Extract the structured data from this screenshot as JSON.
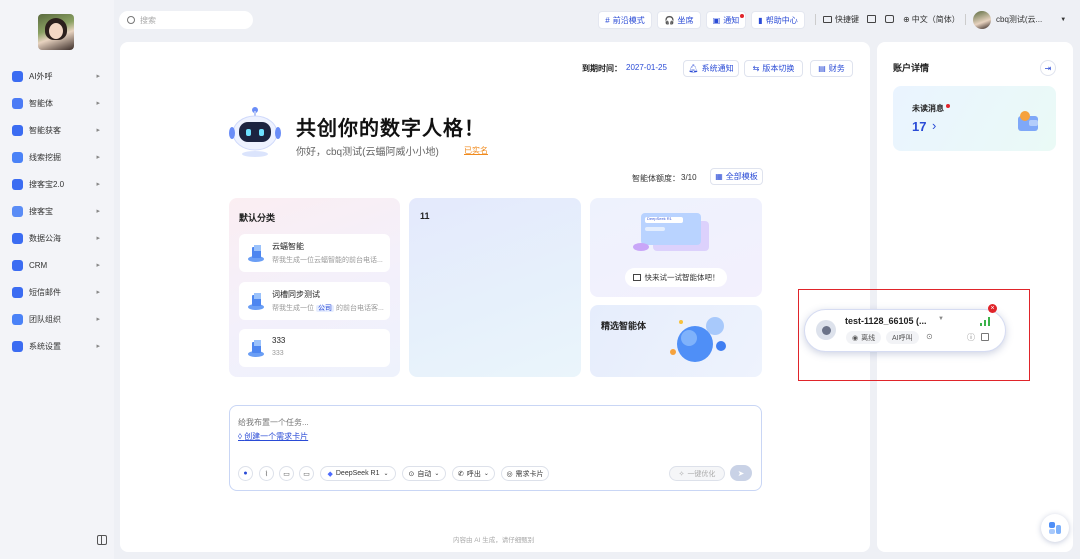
{
  "sidebar": {
    "items": [
      {
        "label": "AI外呼",
        "icon": "phone-robot-icon",
        "color": "#3b6cf2"
      },
      {
        "label": "智能体",
        "icon": "agent-icon",
        "color": "#4c7bf5"
      },
      {
        "label": "智能获客",
        "icon": "customer-icon",
        "color": "#3b6cf2"
      },
      {
        "label": "线索挖掘",
        "icon": "clue-icon",
        "color": "#4a82f7"
      },
      {
        "label": "搜客宝2.0",
        "icon": "search-customer-icon",
        "color": "#3b6cf2"
      },
      {
        "label": "搜客宝",
        "icon": "search-customer-icon",
        "color": "#5a8cf6"
      },
      {
        "label": "数据公海",
        "icon": "data-sea-icon",
        "color": "#3b6cf2"
      },
      {
        "label": "CRM",
        "icon": "crm-icon",
        "color": "#3b6cf2"
      },
      {
        "label": "短信邮件",
        "icon": "mail-icon",
        "color": "#3b6cf2"
      },
      {
        "label": "团队组织",
        "icon": "team-icon",
        "color": "#4a82f7"
      },
      {
        "label": "系统设置",
        "icon": "gear-icon",
        "color": "#3b6cf2"
      }
    ]
  },
  "topbar": {
    "search_placeholder": "搜索",
    "buttons": [
      "前沿模式",
      "坐席",
      "通知",
      "帮助中心"
    ],
    "links": [
      "快捷键",
      "中文（简体）"
    ],
    "user_name": "cbq测试(云..."
  },
  "main": {
    "expire_label": "到期时间：",
    "expire_date": "2027-01-25",
    "header_chips": [
      "系统通知",
      "版本切换",
      "财务"
    ],
    "hero_title": "共创你的数字人格！",
    "hero_greeting": "你好，cbq测试(云蝠阿威小小地)",
    "hero_verified": "已实名",
    "quota_label": "智能体额度：",
    "quota_value": "3/10",
    "all_templates": "全部模板",
    "default_category": "默认分类",
    "agents": [
      {
        "title": "云蝠智能",
        "desc": "帮我生成一位云蝠智能的前台电话..."
      },
      {
        "title": "词槽同步测试",
        "desc_pre": "帮我生成一位",
        "desc_tag": "公司",
        "desc_post": "的前台电话客..."
      },
      {
        "title": "333",
        "desc": "333"
      }
    ],
    "card2_title": "11",
    "deepseek_card_button": "快来试一试智能体吧！",
    "deepseek_badge": "DeepSeek R1",
    "featured_title": "精选智能体",
    "input_placeholder": "给我布置一个任务...",
    "create_link": "创建一个需求卡片",
    "tools": [
      "DeepSeek R1",
      "自动",
      "呼出",
      "需求卡片"
    ],
    "optimize_label": "一键优化",
    "footer_note": "内容由 AI 生成，请仔细甄别"
  },
  "right": {
    "title": "账户详情",
    "unread_label": "未读消息",
    "unread_count": "17"
  },
  "float_widget": {
    "name": "test-1128_66105 (...",
    "status": "离线",
    "mode": "AI呼叫"
  },
  "colors": {
    "accent": "#2a4bd6",
    "highlight_box": "#e0242a",
    "online_signal": "#3bb34a"
  }
}
